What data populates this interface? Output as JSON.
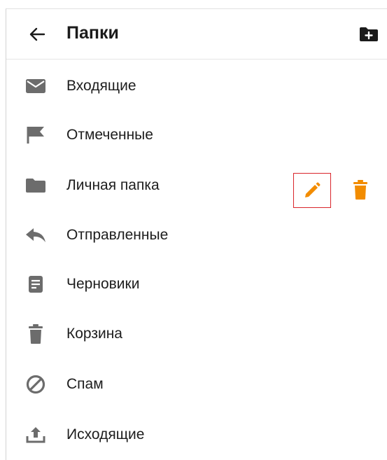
{
  "header": {
    "title": "Папки",
    "back_icon": "arrow-left-icon",
    "new_folder_icon": "folder-plus-icon"
  },
  "folders": [
    {
      "label": "Входящие",
      "icon": "envelope-icon"
    },
    {
      "label": "Отмеченные",
      "icon": "flag-icon"
    },
    {
      "label": "Личная папка",
      "icon": "folder-icon"
    },
    {
      "label": "Отправленные",
      "icon": "reply-icon"
    },
    {
      "label": "Черновики",
      "icon": "document-icon"
    },
    {
      "label": "Корзина",
      "icon": "trash-icon"
    },
    {
      "label": "Спам",
      "icon": "spam-icon"
    },
    {
      "label": "Исходящие",
      "icon": "upload-icon"
    }
  ],
  "row_actions": {
    "edit_icon": "pencil-icon",
    "delete_icon": "trash-icon"
  },
  "colors": {
    "icon_gray": "#6c6c6c",
    "accent_orange": "#f28c00",
    "highlight_red": "#d9252b",
    "text": "#1b1b1b"
  }
}
